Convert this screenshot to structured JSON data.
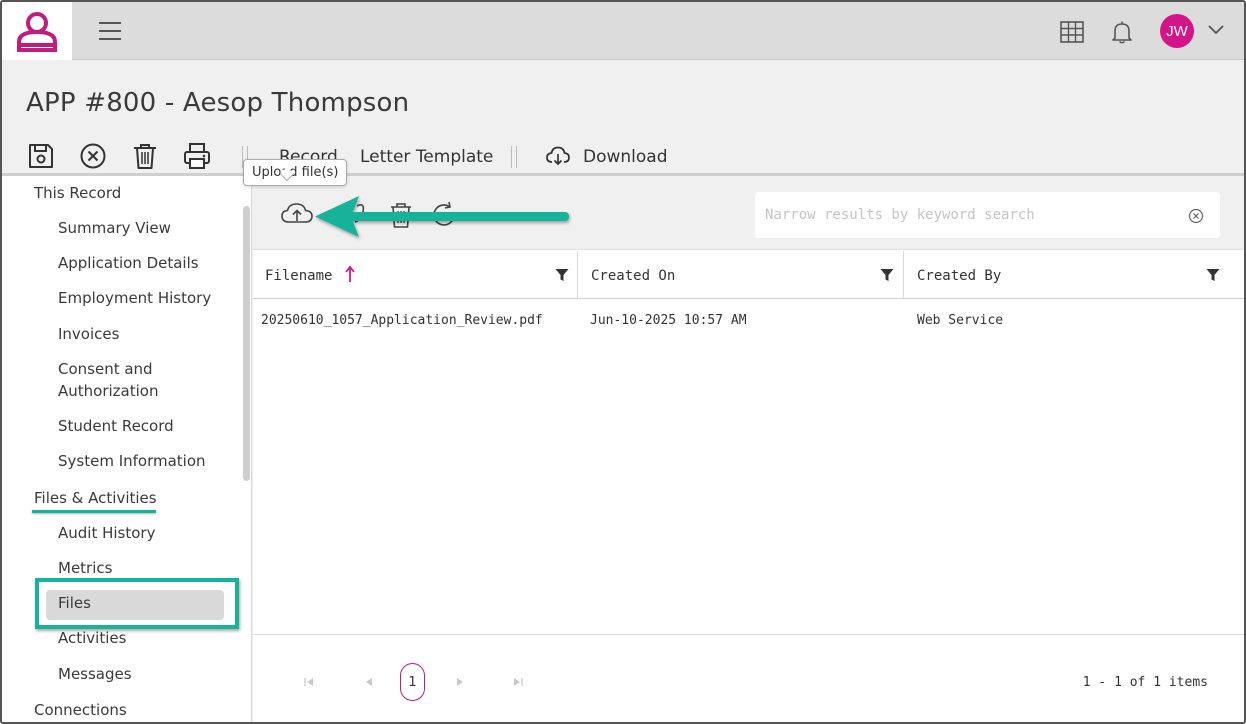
{
  "header": {
    "avatar_initials": "JW",
    "brand_color": "#c21a7d",
    "icons": [
      "user-lock-logo",
      "hamburger-icon",
      "grid-icon",
      "bell-icon",
      "chevron-down-icon"
    ]
  },
  "page": {
    "title": "APP #800 - Aesop Thompson"
  },
  "toolbar": {
    "record_label": "Record",
    "letter_template_label": "Letter Template",
    "download_label": "Download",
    "icons": [
      "save-icon",
      "cancel-icon",
      "trash-icon",
      "print-icon",
      "download-cloud-icon"
    ]
  },
  "sidebar": {
    "sections": [
      {
        "label": "This Record",
        "items": [
          "Summary View",
          "Application Details",
          "Employment History",
          "Invoices",
          "Consent and",
          "Authorization",
          "Student Record",
          "System Information"
        ]
      },
      {
        "label": "Files & Activities",
        "items": [
          "Audit History",
          "Metrics",
          "Files",
          "Activities",
          "Messages"
        ]
      },
      {
        "label": "Connections",
        "items": []
      }
    ],
    "active_item": "Files"
  },
  "files": {
    "tooltip": "Upload file(s)",
    "search_placeholder": "Narrow results by keyword search",
    "columns": [
      "Filename",
      "Created On",
      "Created By"
    ],
    "rows": [
      {
        "filename": "20250610_1057_Application_Review.pdf",
        "created_on": "Jun-10-2025 10:57 AM",
        "created_by": "Web Service"
      }
    ],
    "pager": {
      "current_page": "1",
      "info": "1 - 1 of 1 items"
    }
  },
  "annotation_color": "#14b39a"
}
